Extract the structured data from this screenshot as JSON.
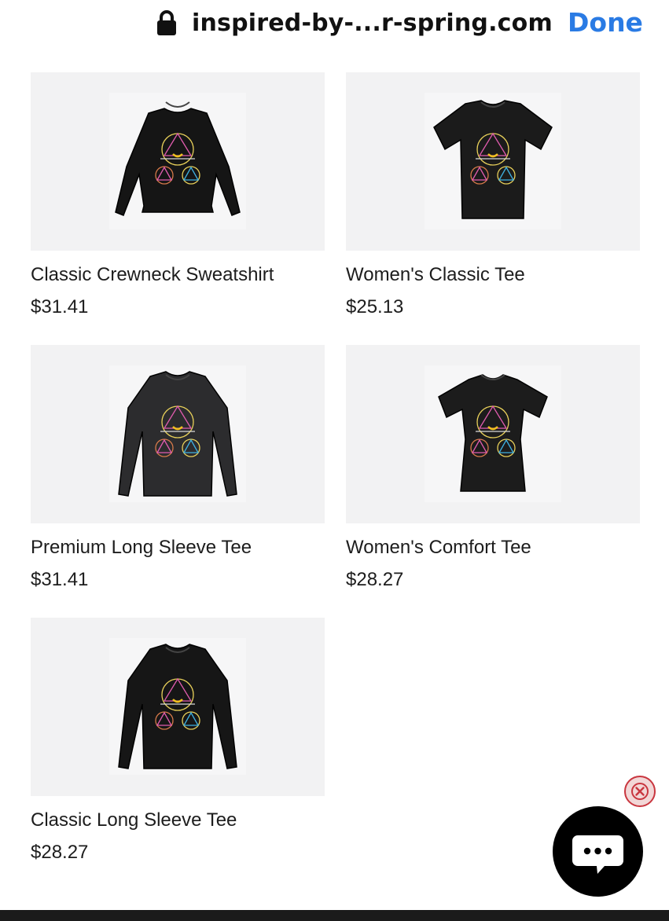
{
  "browser": {
    "url": "inspired-by-...r-spring.com",
    "done_label": "Done",
    "lock_icon": "lock-icon",
    "accent_color": "#2a7be4"
  },
  "products": [
    {
      "name": "Classic Crewneck Sweatshirt",
      "price": "$31.41",
      "garment": "sweatshirt",
      "shirt_color": "#151515"
    },
    {
      "name": "Women's Classic Tee",
      "price": "$25.13",
      "garment": "tee",
      "shirt_color": "#1b1b1b"
    },
    {
      "name": "Premium Long Sleeve Tee",
      "price": "$31.41",
      "garment": "longsleeve",
      "shirt_color": "#2c2c2e"
    },
    {
      "name": "Women's Comfort Tee",
      "price": "$28.27",
      "garment": "fitted-tee",
      "shirt_color": "#1c1c1c"
    },
    {
      "name": "Classic Long Sleeve Tee",
      "price": "$28.27",
      "garment": "longsleeve",
      "shirt_color": "#161616"
    }
  ],
  "chat_widget": {
    "icon": "chat-bubble-icon",
    "close_icon": "close-icon"
  }
}
